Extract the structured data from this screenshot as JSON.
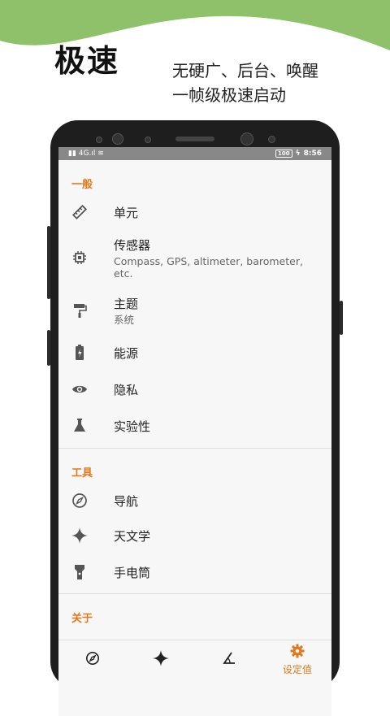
{
  "hero": {
    "title": "极速",
    "subtitle_line1": "无硬广、后台、唤醒",
    "subtitle_line2": "一帧级极速启动"
  },
  "status_bar": {
    "time": "8:56",
    "battery": "100",
    "network": "4G"
  },
  "colors": {
    "accent": "#e07a1e",
    "wave": "#8ec16a",
    "icon": "#555555"
  },
  "sections": [
    {
      "title": "一般",
      "items": [
        {
          "icon": "ruler-icon",
          "label": "单元"
        },
        {
          "icon": "chip-icon",
          "label": "传感器",
          "subtitle": "Compass, GPS, altimeter, barometer, etc."
        },
        {
          "icon": "paint-roller-icon",
          "label": "主题",
          "subtitle": "系统"
        },
        {
          "icon": "battery-charging-icon",
          "label": "能源"
        },
        {
          "icon": "eye-icon",
          "label": "隐私"
        },
        {
          "icon": "flask-icon",
          "label": "实验性"
        }
      ]
    },
    {
      "title": "工具",
      "items": [
        {
          "icon": "compass-icon",
          "label": "导航"
        },
        {
          "icon": "star-icon",
          "label": "天文学"
        },
        {
          "icon": "flashlight-icon",
          "label": "手电筒"
        }
      ]
    },
    {
      "title": "关于"
    }
  ],
  "bottom_nav": [
    {
      "icon": "compass-icon",
      "label": ""
    },
    {
      "icon": "star-icon",
      "label": ""
    },
    {
      "icon": "angle-icon",
      "label": ""
    },
    {
      "icon": "gear-icon",
      "label": "设定值",
      "active": true
    }
  ]
}
